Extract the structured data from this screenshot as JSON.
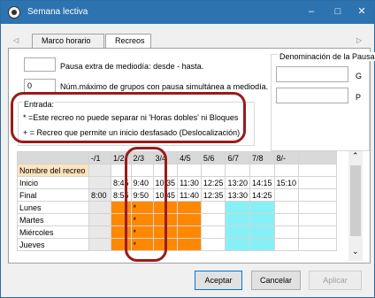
{
  "window": {
    "title": "Semana lectiva",
    "minimize": "–",
    "maximize": "□",
    "close": "✕"
  },
  "tabs": [
    {
      "label": "Marco horario"
    },
    {
      "label": "Recreos"
    }
  ],
  "tab_nav": {
    "left": "◁",
    "right": "▷"
  },
  "fields": {
    "pausa_label": "Pausa extra de mediodía: desde - hasta.",
    "max_groups_value": "0",
    "max_groups_label": "Núm.máximo de grupos con pausa simultánea a mediodía."
  },
  "denominacion": {
    "title": "Denominación de la Pausa",
    "g": "G",
    "p": "P"
  },
  "entrada": {
    "title": "Entrada:",
    "line1": "* =Este recreo no puede separar ni 'Horas dobles' ni Bloques",
    "line2": "+ = Recreo que permite un inicio desfasado (Deslocalización)"
  },
  "grid": {
    "columns": [
      "",
      "-/1",
      "1/2",
      "2/3",
      "3/4",
      "4/5",
      "5/6",
      "6/7",
      "7/8",
      "8/-"
    ],
    "rows": [
      {
        "label": "Nombre del recreo",
        "cells": [
          "",
          "",
          "",
          "",
          "",
          "",
          "",
          "",
          ""
        ]
      },
      {
        "label": "Inicio",
        "cells": [
          "",
          "8:45",
          "9:40",
          "10:35",
          "11:30",
          "12:25",
          "13:20",
          "14:15",
          "15:10"
        ]
      },
      {
        "label": "Final",
        "cells": [
          "8:00",
          "8:55",
          "9:50",
          "10:45",
          "11:40",
          "12:35",
          "13:30",
          "14:25",
          ""
        ]
      },
      {
        "label": "Lunes",
        "cells": [
          "",
          "",
          "*",
          "",
          "",
          "",
          "",
          "",
          ""
        ]
      },
      {
        "label": "Martes",
        "cells": [
          "",
          "",
          "*",
          "",
          "",
          "",
          "",
          "",
          ""
        ]
      },
      {
        "label": "Miércoles",
        "cells": [
          "",
          "",
          "*",
          "",
          "",
          "",
          "",
          "",
          ""
        ]
      },
      {
        "label": "Jueves",
        "cells": [
          "",
          "",
          "*",
          "",
          "",
          "",
          "",
          "",
          ""
        ]
      }
    ]
  },
  "scroll": {
    "up": "⌃",
    "down": "⌄"
  },
  "buttons": {
    "accept": "Aceptar",
    "cancel": "Cancelar",
    "apply": "Aplicar"
  },
  "colors": {
    "titlebar": "#2d73b0",
    "orange": "#ff8800",
    "cyan": "#86f0f6",
    "annotation": "#9a1b1b"
  }
}
